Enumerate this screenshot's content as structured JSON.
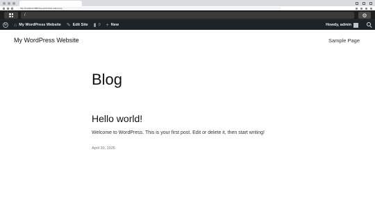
{
  "browser": {
    "tab_title": "",
    "url": "http://localhost:8881/wp-admin/site-editor.php"
  },
  "editor": {
    "path": "/",
    "settings_icon": "gear-icon",
    "logo_icon": "grid-icon"
  },
  "admin_bar": {
    "wp_logo_icon": "wordpress-logo-icon",
    "site_name": "My WordPress Website",
    "site_icon": "home-icon",
    "edit_site": "Edit Site",
    "edit_icon": "brush-icon",
    "comments_icon": "comment-icon",
    "comments_count": "0",
    "new_icon": "plus-icon",
    "new_label": "New",
    "howdy": "Howdy, admin",
    "search_icon": "search-icon"
  },
  "site": {
    "title": "My WordPress Website",
    "nav": [
      "Sample Page"
    ]
  },
  "page": {
    "heading": "Blog",
    "posts": [
      {
        "title": "Hello world!",
        "excerpt": "Welcome to WordPress. This is your first post. Edit or delete it, then start writing!",
        "date": "April 30, 2025"
      }
    ]
  },
  "colors": {
    "admin_bar_bg": "#1d2327",
    "editor_bar_bg": "#1e1e1e"
  }
}
